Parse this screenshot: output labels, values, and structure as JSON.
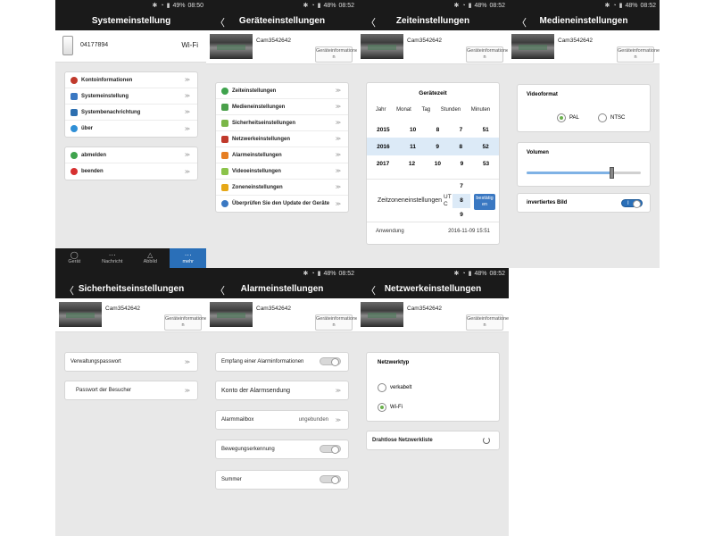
{
  "screens": {
    "s1": {
      "status": {
        "battery": "49%",
        "time": "08:50"
      },
      "title": "Systemeinstellung",
      "account": {
        "id": "04177894",
        "net": "Wi-Fi"
      },
      "items": [
        "Kontoinformationen",
        "Systemeinstellung",
        "Systembenachrichtung",
        "über"
      ],
      "items2": [
        "abmelden",
        "beenden"
      ],
      "nav": [
        "Gerät",
        "Nachricht",
        "Abbild",
        "mehr"
      ]
    },
    "s2": {
      "status": {
        "battery": "48%",
        "time": "08:52"
      },
      "title": "Geräteeinstellungen",
      "cam": "Cam3542642",
      "info": "Geräteinformatione n",
      "items": [
        "Zeiteinstellungen",
        "Medieneinstellungen",
        "Sicherheitseinstellungen",
        "Netzwerkeinstellungen",
        "Alarmeinstellungen",
        "Videoeinstellungen",
        "Zoneneinstellungen",
        "Überprüfen Sie den Update der Geräte"
      ]
    },
    "s3": {
      "status": {
        "battery": "48%",
        "time": "08:52"
      },
      "title": "Zeiteinstellungen",
      "cam": "Cam3542642",
      "info": "Geräteinformatione n",
      "heading": "Gerätezeit",
      "cols": [
        "Jahr",
        "Monat",
        "Tag",
        "Stunden",
        "Minuten"
      ],
      "rows": [
        [
          "2015",
          "10",
          "8",
          "7",
          "51"
        ],
        [
          "2016",
          "11",
          "9",
          "8",
          "52"
        ],
        [
          "2017",
          "12",
          "10",
          "9",
          "53"
        ]
      ],
      "tz_label": "Zeitzoneneinstellungen",
      "tz_utc": "UT C",
      "tz_vals": [
        "7",
        "8",
        "9"
      ],
      "confirm": "bestätig en",
      "apply_label": "Anwendung",
      "apply_time": "2016-11-09 15:51"
    },
    "s4": {
      "status": {
        "battery": "48%",
        "time": "08:52"
      },
      "title": "Medieneinstellungen",
      "cam": "Cam3542642",
      "info": "Geräteinformatione n",
      "videoformat": "Videoformat",
      "pal": "PAL",
      "ntsc": "NTSC",
      "volume": "Volumen",
      "volume_level": 0.75,
      "inverted": "invertiertes Bild",
      "toggle_on": "I"
    },
    "s5": {
      "status": {
        "battery": "48%",
        "time": "08:52"
      },
      "title": "Sicherheitseinstellungen",
      "cam": "Cam3542642",
      "info": "Geräteinformatione n",
      "items": [
        "Verwaltungspasswort",
        "Passwort der Besucher"
      ]
    },
    "s6": {
      "status": {
        "battery": "48%",
        "time": "08:52"
      },
      "title": "Alarmeinstellungen",
      "cam": "Cam3542642",
      "info": "Geräteinformatione n",
      "empfang": "Empfang einer Alarminformationen",
      "konto": "Konto der Alarmsendung",
      "mailbox": "Alarmmailbox",
      "mailbox_val": "ungebunden",
      "bewegung": "Bewegungserkennung",
      "summer": "Summer"
    },
    "s7": {
      "status": {
        "battery": "48%",
        "time": "08:52"
      },
      "title": "Netzwerkeinstellungen",
      "cam": "Cam3542642",
      "info": "Geräteinformatione n",
      "nettype": "Netzwerktyp",
      "wired": "verkabelt",
      "wifi": "Wi-Fi",
      "wlist": "Drahtlose Netzwerkliste"
    }
  },
  "chevron": "≫",
  "back": "〈",
  "icons": {
    "bluetooth": "✱",
    "wifi": "◔",
    "signal": "▮"
  }
}
